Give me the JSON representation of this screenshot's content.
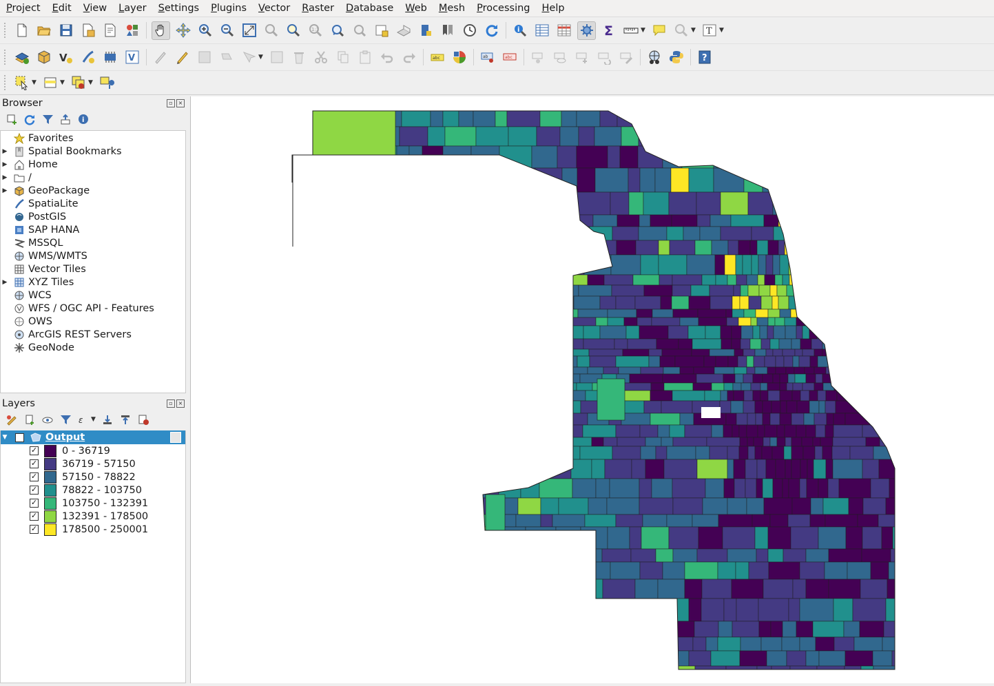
{
  "menubar": [
    "Project",
    "Edit",
    "View",
    "Layer",
    "Settings",
    "Plugins",
    "Vector",
    "Raster",
    "Database",
    "Web",
    "Mesh",
    "Processing",
    "Help"
  ],
  "browser": {
    "title": "Browser",
    "items": [
      {
        "label": "Favorites",
        "icon": "star-icon",
        "expandable": false
      },
      {
        "label": "Spatial Bookmarks",
        "icon": "bookmarks-icon",
        "expandable": true
      },
      {
        "label": "Home",
        "icon": "home-folder-icon",
        "expandable": true
      },
      {
        "label": "/",
        "icon": "folder-icon",
        "expandable": true
      },
      {
        "label": "GeoPackage",
        "icon": "geopackage-icon",
        "expandable": true
      },
      {
        "label": "SpatiaLite",
        "icon": "spatialite-icon",
        "expandable": false
      },
      {
        "label": "PostGIS",
        "icon": "postgis-icon",
        "expandable": false
      },
      {
        "label": "SAP HANA",
        "icon": "sap-hana-icon",
        "expandable": false
      },
      {
        "label": "MSSQL",
        "icon": "mssql-icon",
        "expandable": false
      },
      {
        "label": "WMS/WMTS",
        "icon": "wms-icon",
        "expandable": false
      },
      {
        "label": "Vector Tiles",
        "icon": "vector-tiles-icon",
        "expandable": false
      },
      {
        "label": "XYZ Tiles",
        "icon": "xyz-tiles-icon",
        "expandable": true
      },
      {
        "label": "WCS",
        "icon": "wcs-icon",
        "expandable": false
      },
      {
        "label": "WFS / OGC API - Features",
        "icon": "wfs-icon",
        "expandable": false
      },
      {
        "label": "OWS",
        "icon": "ows-icon",
        "expandable": false
      },
      {
        "label": "ArcGIS REST Servers",
        "icon": "arcgis-icon",
        "expandable": false
      },
      {
        "label": "GeoNode",
        "icon": "geonode-icon",
        "expandable": false
      }
    ]
  },
  "layers": {
    "title": "Layers",
    "layer_name": "Output",
    "classes": [
      {
        "label": "0 - 36719",
        "color": "#440154"
      },
      {
        "label": "36719 - 57150",
        "color": "#443a83"
      },
      {
        "label": "57150 - 78822",
        "color": "#31688e"
      },
      {
        "label": "78822 - 103750",
        "color": "#21908d"
      },
      {
        "label": "103750 - 132391",
        "color": "#35b779"
      },
      {
        "label": "132391 - 178500",
        "color": "#8fd744"
      },
      {
        "label": "178500 - 250001",
        "color": "#fde725"
      }
    ]
  }
}
